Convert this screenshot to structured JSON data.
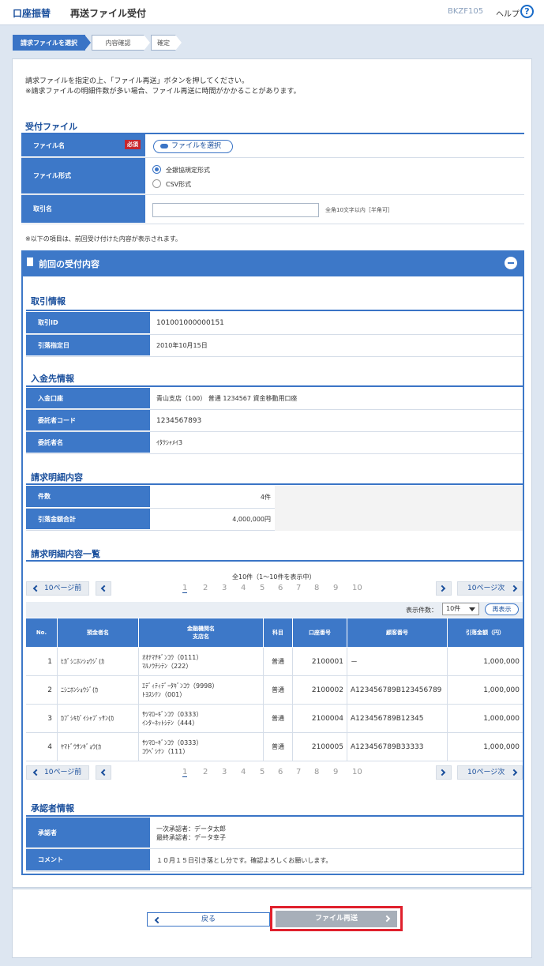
{
  "header": {
    "category": "口座振替",
    "title": "再送ファイル受付",
    "code": "BKZF105",
    "help": "ヘルプ",
    "help_icon": "?"
  },
  "steps": [
    "請求ファイルを選択",
    "内容確認",
    "確定"
  ],
  "intro": [
    "請求ファイルを指定の上、「ファイル再送」ボタンを押してください。",
    "※請求ファイルの明細件数が多い場合、ファイル再送に時間がかかることがあります。"
  ],
  "upload": {
    "title": "受付ファイル",
    "file_label": "ファイル名",
    "required": "必須",
    "file_button": "ファイルを選択",
    "format_label": "ファイル形式",
    "format_options": [
      "全銀協規定形式",
      "CSV形式"
    ],
    "name_label": "取引名",
    "name_value": "",
    "name_hint": "全角10文字以内［半角可］"
  },
  "note": "※以下の項目は、前回受け付けた内容が表示されます。",
  "previous": {
    "title": "前回の受付内容"
  },
  "trade": {
    "title": "取引情報",
    "id_label": "取引ID",
    "id_value": "101001000000151",
    "date_label": "引落指定日",
    "date_value": "2010年10月15日"
  },
  "payee": {
    "title": "入金先情報",
    "account_label": "入金口座",
    "account_value": "青山支店（100） 普通 1234567 資金移動用口座",
    "code_label": "委託者コード",
    "code_value": "1234567893",
    "name_label": "委託者名",
    "name_value": "ｲﾀｸｼｬﾒｲ3"
  },
  "detail": {
    "title": "請求明細内容",
    "count_label": "件数",
    "count_value": "4件",
    "total_label": "引落金額合計",
    "total_value": "4,000,000円"
  },
  "list": {
    "title": "請求明細内容一覧",
    "summary": "全10件（1～10件を表示中）",
    "prev10": "10ページ前",
    "next10": "10ページ次",
    "pages": [
      "1",
      "2",
      "3",
      "4",
      "5",
      "6",
      "7",
      "8",
      "9",
      "10"
    ],
    "display_label": "表示件数：",
    "display_value": "10件",
    "reshow": "再表示",
    "headers": [
      "No.",
      "預金者名",
      "金融機関名\n支店名",
      "科目",
      "口座番号",
      "顧客番号",
      "引落金額（円）"
    ],
    "rows": [
      {
        "no": "1",
        "name": "ﾋｶﾞｼﾆﾎﾝｼｮｳｼﾞ(ｶ",
        "bank": "ｵｵﾃﾏﾁｷﾞﾝｺｳ（0111）",
        "branch": "ﾏﾙﾉｳﾁｼﾃﾝ（222）",
        "type": "普通",
        "acct": "2100001",
        "cust": "－",
        "amount": "1,000,000"
      },
      {
        "no": "2",
        "name": "ﾆｼﾆﾎﾝｼｮｳｼﾞ(ｶ",
        "bank": "ｴﾃﾞｨﾃｨﾃﾞｰﾀｷﾞﾝｺｳ（9998）",
        "branch": "ﾄﾖｽｼﾃﾝ（001）",
        "type": "普通",
        "acct": "2100002",
        "cust": "A123456789B123456789",
        "amount": "1,000,000"
      },
      {
        "no": "3",
        "name": "ｶﾌﾞｼｷｶﾞｲｼｬﾌﾞｯｻﾝ(ｶ",
        "bank": "ｻﾂﾏﾛｰｷﾞﾝｺｳ（0333）",
        "branch": "ｲﾝﾀｰﾈｯﾄｼﾃﾝ（444）",
        "type": "普通",
        "acct": "2100004",
        "cust": "A123456789B12345",
        "amount": "1,000,000"
      },
      {
        "no": "4",
        "name": "ﾔﾏﾄﾞｳｻﾝｷﾞｮｳ(ｶ",
        "bank": "ｻﾂﾏﾛｰｷﾞﾝｺｳ（0333）",
        "branch": "ｺｳﾍﾞｼﾃﾝ（111）",
        "type": "普通",
        "acct": "2100005",
        "cust": "A123456789B33333",
        "amount": "1,000,000"
      }
    ]
  },
  "approver": {
    "title": "承認者情報",
    "approver_label": "承認者",
    "approver_lines": [
      "一次承認者：データ太郎",
      "最終承認者：データ幸子"
    ],
    "comment_label": "コメント",
    "comment_value": "１０月１５日引き落とし分です。確認よろしくお願いします。"
  },
  "buttons": {
    "back": "戻る",
    "resend": "ファイル再送"
  }
}
